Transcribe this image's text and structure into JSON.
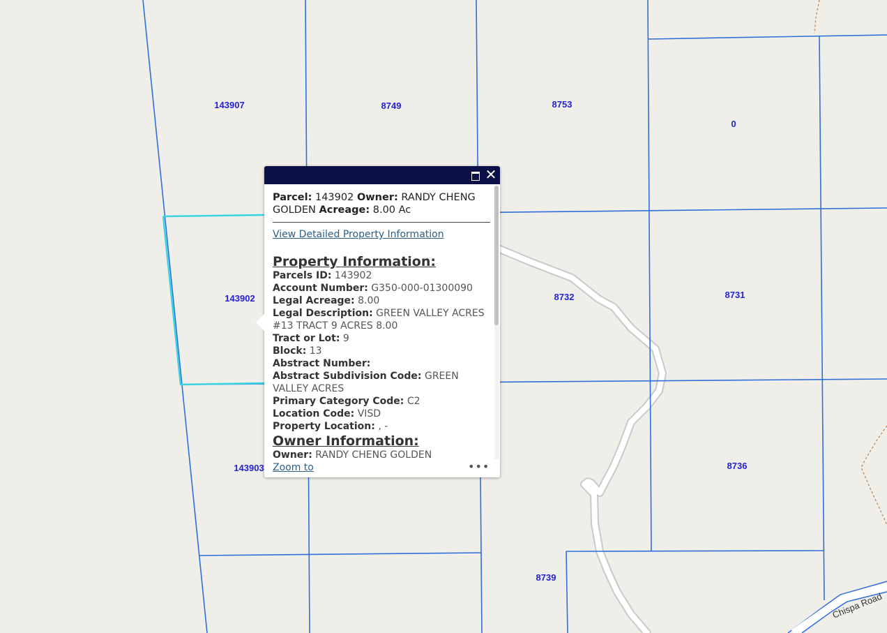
{
  "map": {
    "colors": {
      "background": "#f0eee9",
      "parcel_line": "#2e6fdb",
      "selected_parcel": "#39d4e0",
      "label": "#2323d6",
      "road_fill": "#ffffff",
      "road_casing": "#cfcfcf",
      "trail": "#b8875a"
    },
    "parcel_labels": [
      "143907",
      "8749",
      "8753",
      "0",
      "143902",
      "8732",
      "8731",
      "143903",
      "8736",
      "8739"
    ],
    "road_label": "Chispa Road"
  },
  "popup": {
    "title_prefix": "Parcel:",
    "title_parcel": "143902",
    "title_owner_label": "Owner:",
    "title_owner": "RANDY CHENG GOLDEN",
    "title_acreage_label": "Acreage:",
    "title_acreage": "8.00 Ac",
    "detail_link": "View Detailed Property Information",
    "property_section": "Property Information:",
    "fields": [
      {
        "label": "Parcels ID:",
        "value": "143902"
      },
      {
        "label": "Account Number:",
        "value": "G350-000-01300090"
      },
      {
        "label": "Legal Acreage:",
        "value": "8.00"
      },
      {
        "label": "Legal Description:",
        "value": "GREEN VALLEY ACRES #13 TRACT 9 ACRES 8.00"
      },
      {
        "label": "Tract or Lot:",
        "value": "9"
      },
      {
        "label": "Block:",
        "value": "13"
      },
      {
        "label": "Abstract Number:",
        "value": ""
      },
      {
        "label": "Abstract Subdivision Code:",
        "value": "GREEN VALLEY ACRES"
      },
      {
        "label": "Primary Category Code:",
        "value": "C2"
      },
      {
        "label": "Location Code:",
        "value": "VISD"
      },
      {
        "label": "Property Location:",
        "value": ", -"
      }
    ],
    "owner_section": "Owner Information:",
    "owner_field": {
      "label": "Owner:",
      "value": "RANDY CHENG GOLDEN"
    },
    "zoom_link": "Zoom to",
    "more_icon": "ellipsis-icon",
    "maximize_icon": "maximize-icon",
    "close_icon": "close-icon",
    "header_color": "#0b1146"
  }
}
